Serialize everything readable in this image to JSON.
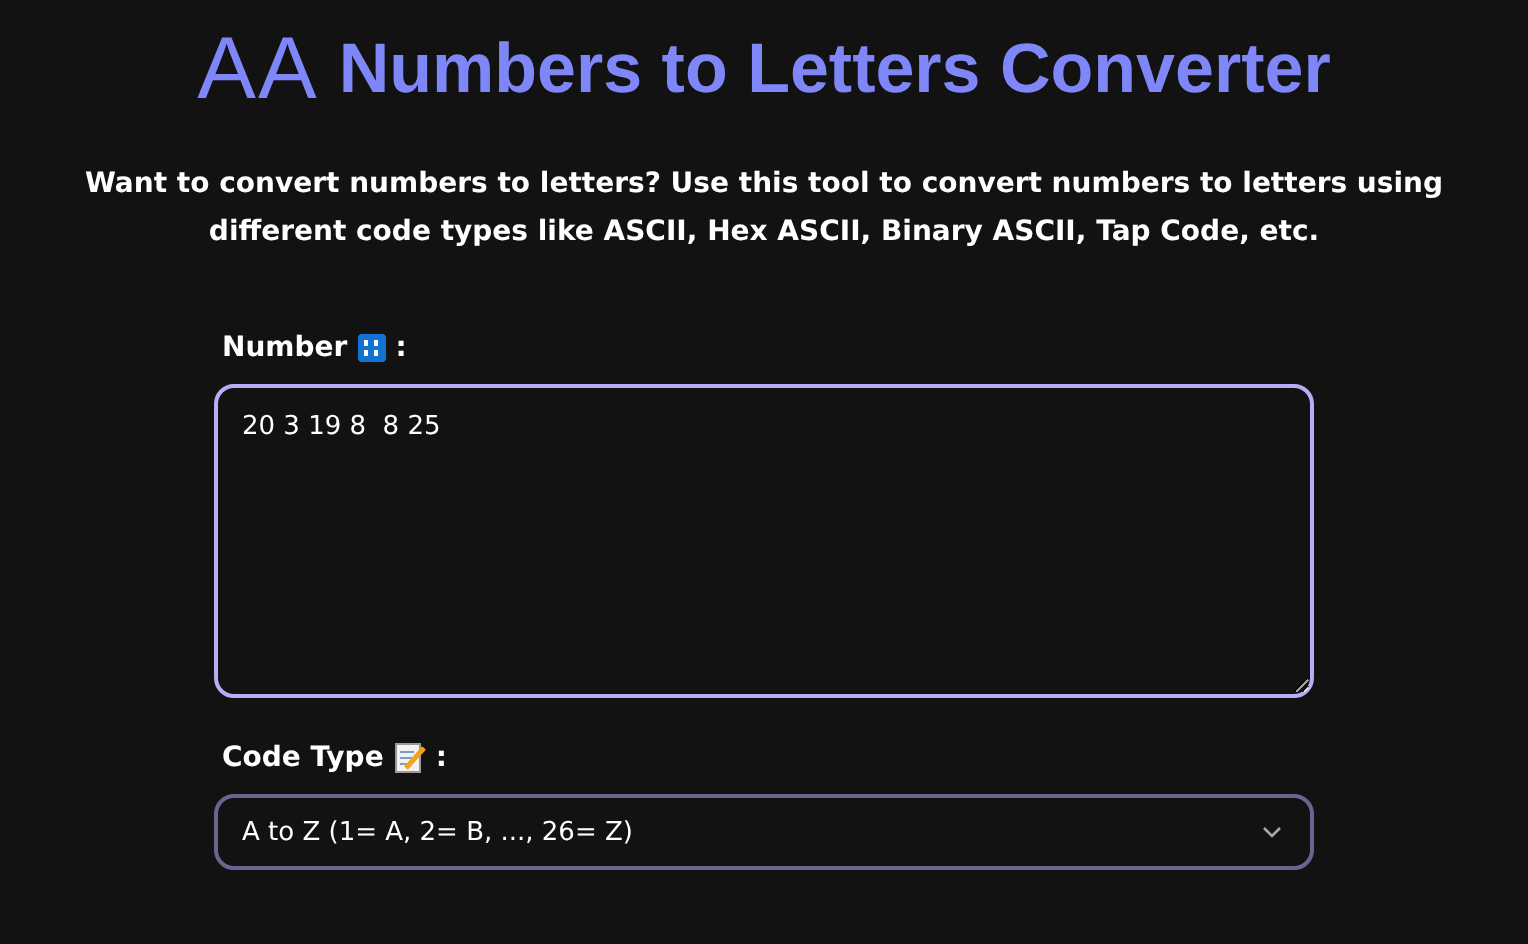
{
  "header": {
    "logo": "AA",
    "title": "Numbers to Letters Converter"
  },
  "description": "Want to convert numbers to letters? Use this tool to convert numbers to letters using different code types like ASCII, Hex ASCII, Binary ASCII, Tap Code, etc.",
  "number_field": {
    "label": "Number",
    "label_suffix": ":",
    "value": "20 3 19 8  8 25",
    "focused": true
  },
  "code_type": {
    "label": "Code Type",
    "label_suffix": ":",
    "value": "A to Z (1= A, 2= B, ..., 26= Z)"
  }
}
